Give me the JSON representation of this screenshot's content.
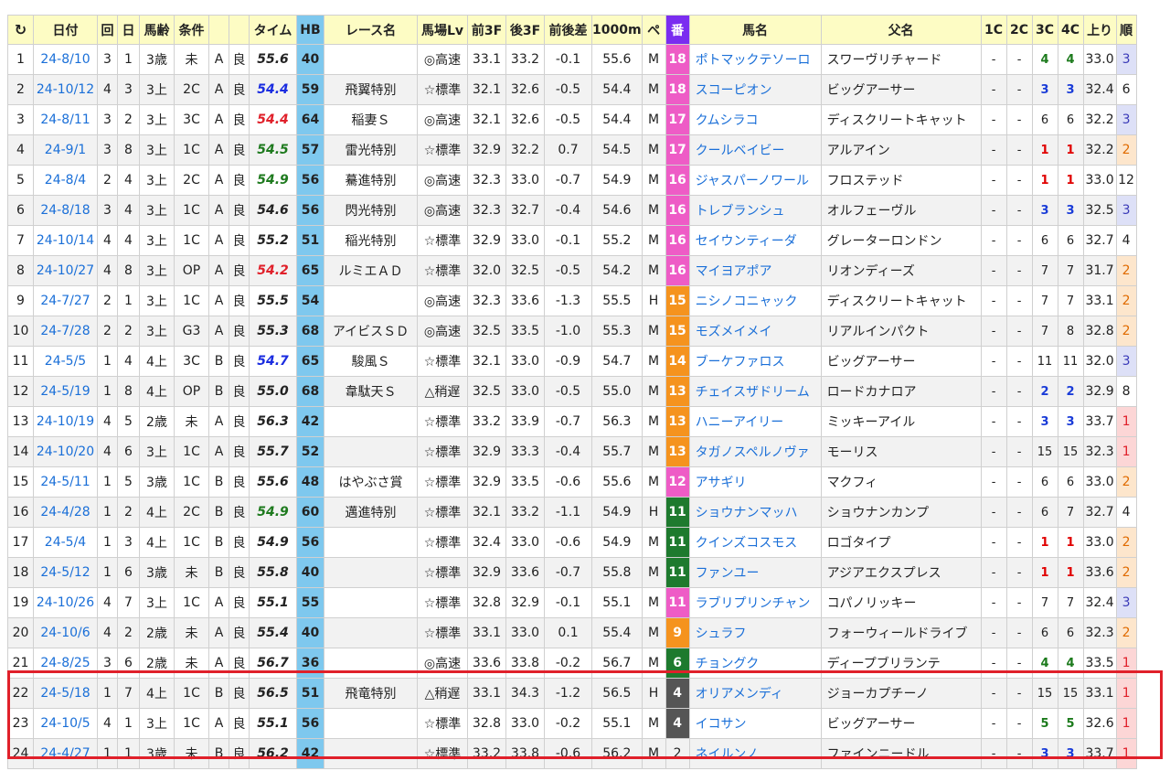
{
  "headers": [
    "日付",
    "回",
    "日",
    "馬齢",
    "条件",
    "",
    "",
    "タイム",
    "HB",
    "レース名",
    "馬場Lv",
    "前3F",
    "後3F",
    "前後差",
    "1000m",
    "ペ",
    "番",
    "馬名",
    "父名",
    "1C",
    "2C",
    "3C",
    "4C",
    "上り",
    "順"
  ],
  "refresh_icon": "refresh-icon",
  "rows": [
    {
      "idx": "1",
      "date": "24-8/10",
      "kai": "3",
      "nichi": "1",
      "age": "3歳",
      "cond": "未",
      "course": "A",
      "baba": "良",
      "time": "55.6",
      "timeColor": "black",
      "hb": "40",
      "race": "",
      "lv": "◎高速",
      "f3": "33.1",
      "l3": "33.2",
      "diff": "-0.1",
      "m1000": "55.6",
      "pace": "M",
      "num": "18",
      "numColor": "#ee5cc6",
      "horse": "ポトマックテソーロ",
      "sire": "スワーヴリチャード",
      "c1": "-",
      "c2": "-",
      "c3": "4",
      "c3c": "green",
      "c4": "4",
      "c4c": "green",
      "agari": "33.0",
      "fin": "3",
      "finBg": "#dde0f7"
    },
    {
      "idx": "2",
      "date": "24-10/12",
      "kai": "4",
      "nichi": "3",
      "age": "3上",
      "cond": "2C",
      "course": "A",
      "baba": "良",
      "time": "54.4",
      "timeColor": "blue",
      "hb": "59",
      "race": "飛翼特別",
      "lv": "☆標準",
      "f3": "32.1",
      "l3": "32.6",
      "diff": "-0.5",
      "m1000": "54.4",
      "pace": "M",
      "num": "18",
      "numColor": "#ee5cc6",
      "horse": "スコーピオン",
      "sire": "ビッグアーサー",
      "c1": "-",
      "c2": "-",
      "c3": "3",
      "c3c": "blue",
      "c4": "3",
      "c4c": "blue",
      "agari": "32.4",
      "fin": "6",
      "finBg": "#ffffff"
    },
    {
      "idx": "3",
      "date": "24-8/11",
      "kai": "3",
      "nichi": "2",
      "age": "3上",
      "cond": "3C",
      "course": "A",
      "baba": "良",
      "time": "54.4",
      "timeColor": "red",
      "hb": "64",
      "race": "稲妻Ｓ",
      "lv": "◎高速",
      "f3": "32.1",
      "l3": "32.6",
      "diff": "-0.5",
      "m1000": "54.4",
      "pace": "M",
      "num": "17",
      "numColor": "#ee5cc6",
      "horse": "クムシラコ",
      "sire": "ディスクリートキャット",
      "c1": "-",
      "c2": "-",
      "c3": "6",
      "c3c": "",
      "c4": "6",
      "c4c": "",
      "agari": "32.2",
      "fin": "3",
      "finBg": "#dde0f7"
    },
    {
      "idx": "4",
      "date": "24-9/1",
      "kai": "3",
      "nichi": "8",
      "age": "3上",
      "cond": "1C",
      "course": "A",
      "baba": "良",
      "time": "54.5",
      "timeColor": "green",
      "hb": "57",
      "race": "雷光特別",
      "lv": "☆標準",
      "f3": "32.9",
      "l3": "32.2",
      "diff": "0.7",
      "m1000": "54.5",
      "pace": "M",
      "num": "17",
      "numColor": "#ee5cc6",
      "horse": "クールベイビー",
      "sire": "アルアイン",
      "c1": "-",
      "c2": "-",
      "c3": "1",
      "c3c": "red",
      "c4": "1",
      "c4c": "red",
      "agari": "32.2",
      "fin": "2",
      "finBg": "#fde6cc"
    },
    {
      "idx": "5",
      "date": "24-8/4",
      "kai": "2",
      "nichi": "4",
      "age": "3上",
      "cond": "2C",
      "course": "A",
      "baba": "良",
      "time": "54.9",
      "timeColor": "green",
      "hb": "56",
      "race": "驀進特別",
      "lv": "◎高速",
      "f3": "32.3",
      "l3": "33.0",
      "diff": "-0.7",
      "m1000": "54.9",
      "pace": "M",
      "num": "16",
      "numColor": "#ee5cc6",
      "horse": "ジャスパーノワール",
      "sire": "フロステッド",
      "c1": "-",
      "c2": "-",
      "c3": "1",
      "c3c": "red",
      "c4": "1",
      "c4c": "red",
      "agari": "33.0",
      "fin": "12",
      "finBg": "#ffffff"
    },
    {
      "idx": "6",
      "date": "24-8/18",
      "kai": "3",
      "nichi": "4",
      "age": "3上",
      "cond": "1C",
      "course": "A",
      "baba": "良",
      "time": "54.6",
      "timeColor": "black",
      "hb": "56",
      "race": "閃光特別",
      "lv": "◎高速",
      "f3": "32.3",
      "l3": "32.7",
      "diff": "-0.4",
      "m1000": "54.6",
      "pace": "M",
      "num": "16",
      "numColor": "#ee5cc6",
      "horse": "トレブランシュ",
      "sire": "オルフェーヴル",
      "c1": "-",
      "c2": "-",
      "c3": "3",
      "c3c": "blue",
      "c4": "3",
      "c4c": "blue",
      "agari": "32.5",
      "fin": "3",
      "finBg": "#dde0f7"
    },
    {
      "idx": "7",
      "date": "24-10/14",
      "kai": "4",
      "nichi": "4",
      "age": "3上",
      "cond": "1C",
      "course": "A",
      "baba": "良",
      "time": "55.2",
      "timeColor": "black",
      "hb": "51",
      "race": "稲光特別",
      "lv": "☆標準",
      "f3": "32.9",
      "l3": "33.0",
      "diff": "-0.1",
      "m1000": "55.2",
      "pace": "M",
      "num": "16",
      "numColor": "#ee5cc6",
      "horse": "セイウンティーダ",
      "sire": "グレーターロンドン",
      "c1": "-",
      "c2": "-",
      "c3": "6",
      "c3c": "",
      "c4": "6",
      "c4c": "",
      "agari": "32.7",
      "fin": "4",
      "finBg": "#ffffff"
    },
    {
      "idx": "8",
      "date": "24-10/27",
      "kai": "4",
      "nichi": "8",
      "age": "3上",
      "cond": "OP",
      "course": "A",
      "baba": "良",
      "time": "54.2",
      "timeColor": "red",
      "hb": "65",
      "race": "ルミエＡＤ",
      "lv": "☆標準",
      "f3": "32.0",
      "l3": "32.5",
      "diff": "-0.5",
      "m1000": "54.2",
      "pace": "M",
      "num": "16",
      "numColor": "#ee5cc6",
      "horse": "マイヨアポア",
      "sire": "リオンディーズ",
      "c1": "-",
      "c2": "-",
      "c3": "7",
      "c3c": "",
      "c4": "7",
      "c4c": "",
      "agari": "31.7",
      "fin": "2",
      "finBg": "#fde6cc"
    },
    {
      "idx": "9",
      "date": "24-7/27",
      "kai": "2",
      "nichi": "1",
      "age": "3上",
      "cond": "1C",
      "course": "A",
      "baba": "良",
      "time": "55.5",
      "timeColor": "black",
      "hb": "54",
      "race": "",
      "lv": "◎高速",
      "f3": "32.3",
      "l3": "33.6",
      "diff": "-1.3",
      "m1000": "55.5",
      "pace": "H",
      "num": "15",
      "numColor": "#f5931e",
      "horse": "ニシノコニャック",
      "sire": "ディスクリートキャット",
      "c1": "-",
      "c2": "-",
      "c3": "7",
      "c3c": "",
      "c4": "7",
      "c4c": "",
      "agari": "33.1",
      "fin": "2",
      "finBg": "#fde6cc"
    },
    {
      "idx": "10",
      "date": "24-7/28",
      "kai": "2",
      "nichi": "2",
      "age": "3上",
      "cond": "G3",
      "course": "A",
      "baba": "良",
      "time": "55.3",
      "timeColor": "black",
      "hb": "68",
      "race": "アイビスＳＤ",
      "lv": "◎高速",
      "f3": "32.5",
      "l3": "33.5",
      "diff": "-1.0",
      "m1000": "55.3",
      "pace": "M",
      "num": "15",
      "numColor": "#f5931e",
      "horse": "モズメイメイ",
      "sire": "リアルインパクト",
      "c1": "-",
      "c2": "-",
      "c3": "7",
      "c3c": "",
      "c4": "8",
      "c4c": "",
      "agari": "32.8",
      "fin": "2",
      "finBg": "#fde6cc"
    },
    {
      "idx": "11",
      "date": "24-5/5",
      "kai": "1",
      "nichi": "4",
      "age": "4上",
      "cond": "3C",
      "course": "B",
      "baba": "良",
      "time": "54.7",
      "timeColor": "blue",
      "hb": "65",
      "race": "駿風Ｓ",
      "lv": "☆標準",
      "f3": "32.1",
      "l3": "33.0",
      "diff": "-0.9",
      "m1000": "54.7",
      "pace": "M",
      "num": "14",
      "numColor": "#f5931e",
      "horse": "ブーケファロス",
      "sire": "ビッグアーサー",
      "c1": "-",
      "c2": "-",
      "c3": "11",
      "c3c": "",
      "c4": "11",
      "c4c": "",
      "agari": "32.0",
      "fin": "3",
      "finBg": "#dde0f7"
    },
    {
      "idx": "12",
      "date": "24-5/19",
      "kai": "1",
      "nichi": "8",
      "age": "4上",
      "cond": "OP",
      "course": "B",
      "baba": "良",
      "time": "55.0",
      "timeColor": "black",
      "hb": "68",
      "race": "韋駄天Ｓ",
      "lv": "△稍遅",
      "f3": "32.5",
      "l3": "33.0",
      "diff": "-0.5",
      "m1000": "55.0",
      "pace": "M",
      "num": "13",
      "numColor": "#f5931e",
      "horse": "チェイスザドリーム",
      "sire": "ロードカナロア",
      "c1": "-",
      "c2": "-",
      "c3": "2",
      "c3c": "blue",
      "c4": "2",
      "c4c": "blue",
      "agari": "32.9",
      "fin": "8",
      "finBg": "#ffffff"
    },
    {
      "idx": "13",
      "date": "24-10/19",
      "kai": "4",
      "nichi": "5",
      "age": "2歳",
      "cond": "未",
      "course": "A",
      "baba": "良",
      "time": "56.3",
      "timeColor": "black",
      "hb": "42",
      "race": "",
      "lv": "☆標準",
      "f3": "33.2",
      "l3": "33.9",
      "diff": "-0.7",
      "m1000": "56.3",
      "pace": "M",
      "num": "13",
      "numColor": "#f5931e",
      "horse": "ハニーアイリー",
      "sire": "ミッキーアイル",
      "c1": "-",
      "c2": "-",
      "c3": "3",
      "c3c": "blue",
      "c4": "3",
      "c4c": "blue",
      "agari": "33.7",
      "fin": "1",
      "finBg": "#fcd6d6"
    },
    {
      "idx": "14",
      "date": "24-10/20",
      "kai": "4",
      "nichi": "6",
      "age": "3上",
      "cond": "1C",
      "course": "A",
      "baba": "良",
      "time": "55.7",
      "timeColor": "black",
      "hb": "52",
      "race": "",
      "lv": "☆標準",
      "f3": "32.9",
      "l3": "33.3",
      "diff": "-0.4",
      "m1000": "55.7",
      "pace": "M",
      "num": "13",
      "numColor": "#f5931e",
      "horse": "タガノスペルノヴァ",
      "sire": "モーリス",
      "c1": "-",
      "c2": "-",
      "c3": "15",
      "c3c": "",
      "c4": "15",
      "c4c": "",
      "agari": "32.3",
      "fin": "1",
      "finBg": "#fcd6d6"
    },
    {
      "idx": "15",
      "date": "24-5/11",
      "kai": "1",
      "nichi": "5",
      "age": "3歳",
      "cond": "1C",
      "course": "B",
      "baba": "良",
      "time": "55.6",
      "timeColor": "black",
      "hb": "48",
      "race": "はやぶさ賞",
      "lv": "☆標準",
      "f3": "32.9",
      "l3": "33.5",
      "diff": "-0.6",
      "m1000": "55.6",
      "pace": "M",
      "num": "12",
      "numColor": "#ee5cc6",
      "horse": "アサギリ",
      "sire": "マクフィ",
      "c1": "-",
      "c2": "-",
      "c3": "6",
      "c3c": "",
      "c4": "6",
      "c4c": "",
      "agari": "33.0",
      "fin": "2",
      "finBg": "#fde6cc"
    },
    {
      "idx": "16",
      "date": "24-4/28",
      "kai": "1",
      "nichi": "2",
      "age": "4上",
      "cond": "2C",
      "course": "B",
      "baba": "良",
      "time": "54.9",
      "timeColor": "green",
      "hb": "60",
      "race": "邁進特別",
      "lv": "☆標準",
      "f3": "32.1",
      "l3": "33.2",
      "diff": "-1.1",
      "m1000": "54.9",
      "pace": "H",
      "num": "11",
      "numColor": "#1e7a2e",
      "horse": "ショウナンマッハ",
      "sire": "ショウナンカンプ",
      "c1": "-",
      "c2": "-",
      "c3": "6",
      "c3c": "",
      "c4": "7",
      "c4c": "",
      "agari": "32.7",
      "fin": "4",
      "finBg": "#ffffff"
    },
    {
      "idx": "17",
      "date": "24-5/4",
      "kai": "1",
      "nichi": "3",
      "age": "4上",
      "cond": "1C",
      "course": "B",
      "baba": "良",
      "time": "54.9",
      "timeColor": "black",
      "hb": "56",
      "race": "",
      "lv": "☆標準",
      "f3": "32.4",
      "l3": "33.0",
      "diff": "-0.6",
      "m1000": "54.9",
      "pace": "M",
      "num": "11",
      "numColor": "#1e7a2e",
      "horse": "クインズコスモス",
      "sire": "ロゴタイプ",
      "c1": "-",
      "c2": "-",
      "c3": "1",
      "c3c": "red",
      "c4": "1",
      "c4c": "red",
      "agari": "33.0",
      "fin": "2",
      "finBg": "#fde6cc"
    },
    {
      "idx": "18",
      "date": "24-5/12",
      "kai": "1",
      "nichi": "6",
      "age": "3歳",
      "cond": "未",
      "course": "B",
      "baba": "良",
      "time": "55.8",
      "timeColor": "black",
      "hb": "40",
      "race": "",
      "lv": "☆標準",
      "f3": "32.9",
      "l3": "33.6",
      "diff": "-0.7",
      "m1000": "55.8",
      "pace": "M",
      "num": "11",
      "numColor": "#1e7a2e",
      "horse": "ファンユー",
      "sire": "アジアエクスプレス",
      "c1": "-",
      "c2": "-",
      "c3": "1",
      "c3c": "red",
      "c4": "1",
      "c4c": "red",
      "agari": "33.6",
      "fin": "2",
      "finBg": "#fde6cc"
    },
    {
      "idx": "19",
      "date": "24-10/26",
      "kai": "4",
      "nichi": "7",
      "age": "3上",
      "cond": "1C",
      "course": "A",
      "baba": "良",
      "time": "55.1",
      "timeColor": "black",
      "hb": "55",
      "race": "",
      "lv": "☆標準",
      "f3": "32.8",
      "l3": "32.9",
      "diff": "-0.1",
      "m1000": "55.1",
      "pace": "M",
      "num": "11",
      "numColor": "#ee5cc6",
      "horse": "ラブリプリンチャン",
      "sire": "コパノリッキー",
      "c1": "-",
      "c2": "-",
      "c3": "7",
      "c3c": "",
      "c4": "7",
      "c4c": "",
      "agari": "32.4",
      "fin": "3",
      "finBg": "#dde0f7"
    },
    {
      "idx": "20",
      "date": "24-10/6",
      "kai": "4",
      "nichi": "2",
      "age": "2歳",
      "cond": "未",
      "course": "A",
      "baba": "良",
      "time": "55.4",
      "timeColor": "black",
      "hb": "40",
      "race": "",
      "lv": "☆標準",
      "f3": "33.1",
      "l3": "33.0",
      "diff": "0.1",
      "m1000": "55.4",
      "pace": "M",
      "num": "9",
      "numColor": "#f5931e",
      "horse": "シュラフ",
      "sire": "フォーウィールドライブ",
      "c1": "-",
      "c2": "-",
      "c3": "6",
      "c3c": "",
      "c4": "6",
      "c4c": "",
      "agari": "32.3",
      "fin": "2",
      "finBg": "#fde6cc"
    },
    {
      "idx": "21",
      "date": "24-8/25",
      "kai": "3",
      "nichi": "6",
      "age": "2歳",
      "cond": "未",
      "course": "A",
      "baba": "良",
      "time": "56.7",
      "timeColor": "black",
      "hb": "36",
      "race": "",
      "lv": "◎高速",
      "f3": "33.6",
      "l3": "33.8",
      "diff": "-0.2",
      "m1000": "56.7",
      "pace": "M",
      "num": "6",
      "numColor": "#1e7a2e",
      "horse": "チョングク",
      "sire": "ディープブリランテ",
      "c1": "-",
      "c2": "-",
      "c3": "4",
      "c3c": "green",
      "c4": "4",
      "c4c": "green",
      "agari": "33.5",
      "fin": "1",
      "finBg": "#fcd6d6"
    },
    {
      "idx": "22",
      "date": "24-5/18",
      "kai": "1",
      "nichi": "7",
      "age": "4上",
      "cond": "1C",
      "course": "B",
      "baba": "良",
      "time": "56.5",
      "timeColor": "black",
      "hb": "51",
      "race": "飛竜特別",
      "lv": "△稍遅",
      "f3": "33.1",
      "l3": "34.3",
      "diff": "-1.2",
      "m1000": "56.5",
      "pace": "H",
      "num": "4",
      "numColor": "#555555",
      "horse": "オリアメンディ",
      "sire": "ジョーカプチーノ",
      "c1": "-",
      "c2": "-",
      "c3": "15",
      "c3c": "",
      "c4": "15",
      "c4c": "",
      "agari": "33.1",
      "fin": "1",
      "finBg": "#fcd6d6"
    },
    {
      "idx": "23",
      "date": "24-10/5",
      "kai": "4",
      "nichi": "1",
      "age": "3上",
      "cond": "1C",
      "course": "A",
      "baba": "良",
      "time": "55.1",
      "timeColor": "black",
      "hb": "56",
      "race": "",
      "lv": "☆標準",
      "f3": "32.8",
      "l3": "33.0",
      "diff": "-0.2",
      "m1000": "55.1",
      "pace": "M",
      "num": "4",
      "numColor": "#555555",
      "horse": "イコサン",
      "sire": "ビッグアーサー",
      "c1": "-",
      "c2": "-",
      "c3": "5",
      "c3c": "green",
      "c4": "5",
      "c4c": "green",
      "agari": "32.6",
      "fin": "1",
      "finBg": "#fcd6d6"
    },
    {
      "idx": "24",
      "date": "24-4/27",
      "kai": "1",
      "nichi": "1",
      "age": "3歳",
      "cond": "未",
      "course": "B",
      "baba": "良",
      "time": "56.2",
      "timeColor": "black",
      "hb": "42",
      "race": "",
      "lv": "☆標準",
      "f3": "33.2",
      "l3": "33.8",
      "diff": "-0.6",
      "m1000": "56.2",
      "pace": "M",
      "num": "2",
      "numColor": "",
      "horse": "ネイルンノ",
      "sire": "ファインニードル",
      "c1": "-",
      "c2": "-",
      "c3": "3",
      "c3c": "blue",
      "c4": "3",
      "c4c": "blue",
      "agari": "33.7",
      "fin": "1",
      "finBg": "#fcd6d6"
    }
  ]
}
